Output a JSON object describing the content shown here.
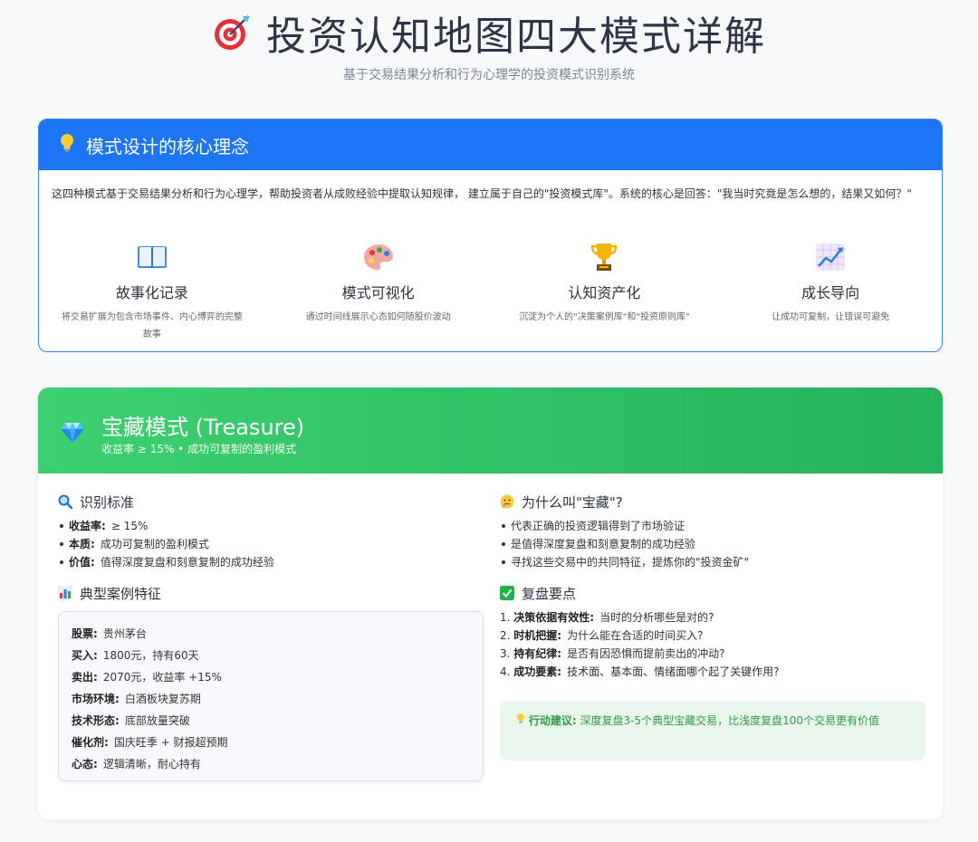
{
  "header": {
    "title": "投资认知地图四大模式详解",
    "subtitle": "基于交易结果分析和行为心理学的投资模式识别系统",
    "title_icon": "target-dart-icon"
  },
  "core": {
    "icon": "lightbulb-icon",
    "heading": "模式设计的核心理念",
    "intro": "这四种模式基于交易结果分析和行为心理学，帮助投资者从成败经验中提取认知规律， 建立属于自己的\"投资模式库\"。系统的核心是回答：\"我当时究竟是怎么想的，结果又如何？\"",
    "pillars": [
      {
        "icon": "open-book-icon",
        "title": "故事化记录",
        "desc": "将交易扩展为包含市场事件、内心博弈的完整故事"
      },
      {
        "icon": "palette-icon",
        "title": "模式可视化",
        "desc": "通过时间线展示心态如何随股价波动"
      },
      {
        "icon": "trophy-icon",
        "title": "认知资产化",
        "desc": "沉淀为个人的\"决策案例库\"和\"投资原则库\""
      },
      {
        "icon": "chart-up-icon",
        "title": "成长导向",
        "desc": "让成功可复制，让错误可避免"
      }
    ]
  },
  "treasure": {
    "icon": "gem-icon",
    "title": "宝藏模式 (Treasure)",
    "subtitle": "收益率 ≥ 15% • 成功可复制的盈利模式",
    "criteria": {
      "icon": "magnifier-icon",
      "title": "识别标准",
      "items": [
        {
          "k": "收益率:",
          "v": "≥ 15%"
        },
        {
          "k": "本质:",
          "v": "成功可复制的盈利模式"
        },
        {
          "k": "价值:",
          "v": "值得深度复盘和刻意复制的成功经验"
        }
      ]
    },
    "why": {
      "icon": "thinking-face-icon",
      "title": "为什么叫\"宝藏\"?",
      "items": [
        "代表正确的投资逻辑得到了市场验证",
        "是值得深度复盘和刻意复制的成功经验",
        "寻找这些交易中的共同特征，提炼你的\"投资金矿\""
      ]
    },
    "case": {
      "icon": "bar-chart-icon",
      "title": "典型案例特征",
      "rows": [
        {
          "k": "股票:",
          "v": "贵州茅台"
        },
        {
          "k": "买入:",
          "v": "1800元，持有60天"
        },
        {
          "k": "卖出:",
          "v": "2070元，收益率 +15%"
        },
        {
          "k": "市场环境:",
          "v": "白酒板块复苏期"
        },
        {
          "k": "技术形态:",
          "v": "底部放量突破"
        },
        {
          "k": "催化剂:",
          "v": "国庆旺季 + 财报超预期"
        },
        {
          "k": "心态:",
          "v": "逻辑清晰，耐心持有"
        }
      ]
    },
    "review": {
      "icon": "check-box-icon",
      "title": "复盘要点",
      "items": [
        {
          "n": "1.",
          "k": "决策依据有效性:",
          "v": "当时的分析哪些是对的?"
        },
        {
          "n": "2.",
          "k": "时机把握:",
          "v": "为什么能在合适的时间买入?"
        },
        {
          "n": "3.",
          "k": "持有纪律:",
          "v": "是否有因恐惧而提前卖出的冲动?"
        },
        {
          "n": "4.",
          "k": "成功要素:",
          "v": "技术面、基本面、情绪面哪个起了关键作用?"
        }
      ]
    },
    "advice": {
      "icon": "lightbulb-icon",
      "label": "行动建议:",
      "text": "深度复盘3-5个典型宝藏交易，比浅度复盘100个交易更有价值"
    }
  },
  "colors": {
    "blue": "#1d74f5",
    "green": "#2ec264",
    "advice_text": "#2f9a4c"
  }
}
